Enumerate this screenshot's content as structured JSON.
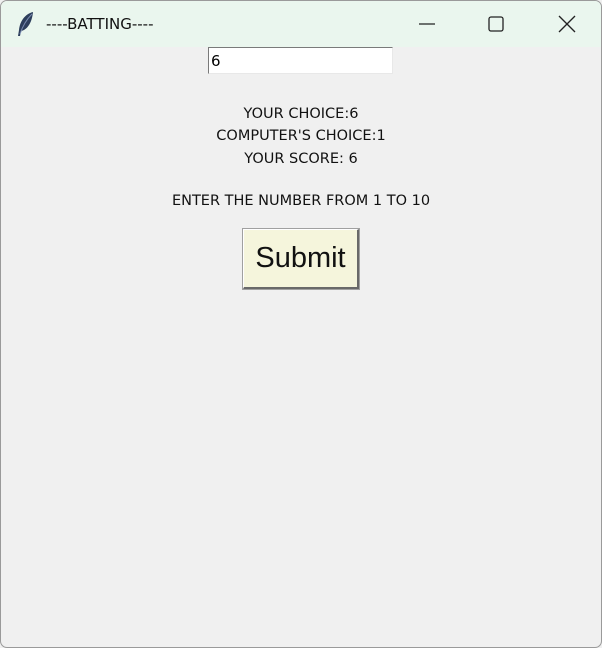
{
  "window": {
    "title": "----BATTING----",
    "icon": "feather-icon",
    "controls": [
      "minimize-icon",
      "maximize-icon",
      "close-icon"
    ]
  },
  "form": {
    "entry_value": "6",
    "your_choice": "YOUR CHOICE:6",
    "computer_choice": "COMPUTER'S CHOICE:1",
    "your_score": "YOUR SCORE: 6",
    "instruction": "ENTER THE NUMBER FROM 1 TO 10",
    "submit_label": "Submit"
  },
  "colors": {
    "titlebar": "#eaf6ee",
    "background": "#f0f0f0",
    "button_bg": "#f5f5dc"
  }
}
